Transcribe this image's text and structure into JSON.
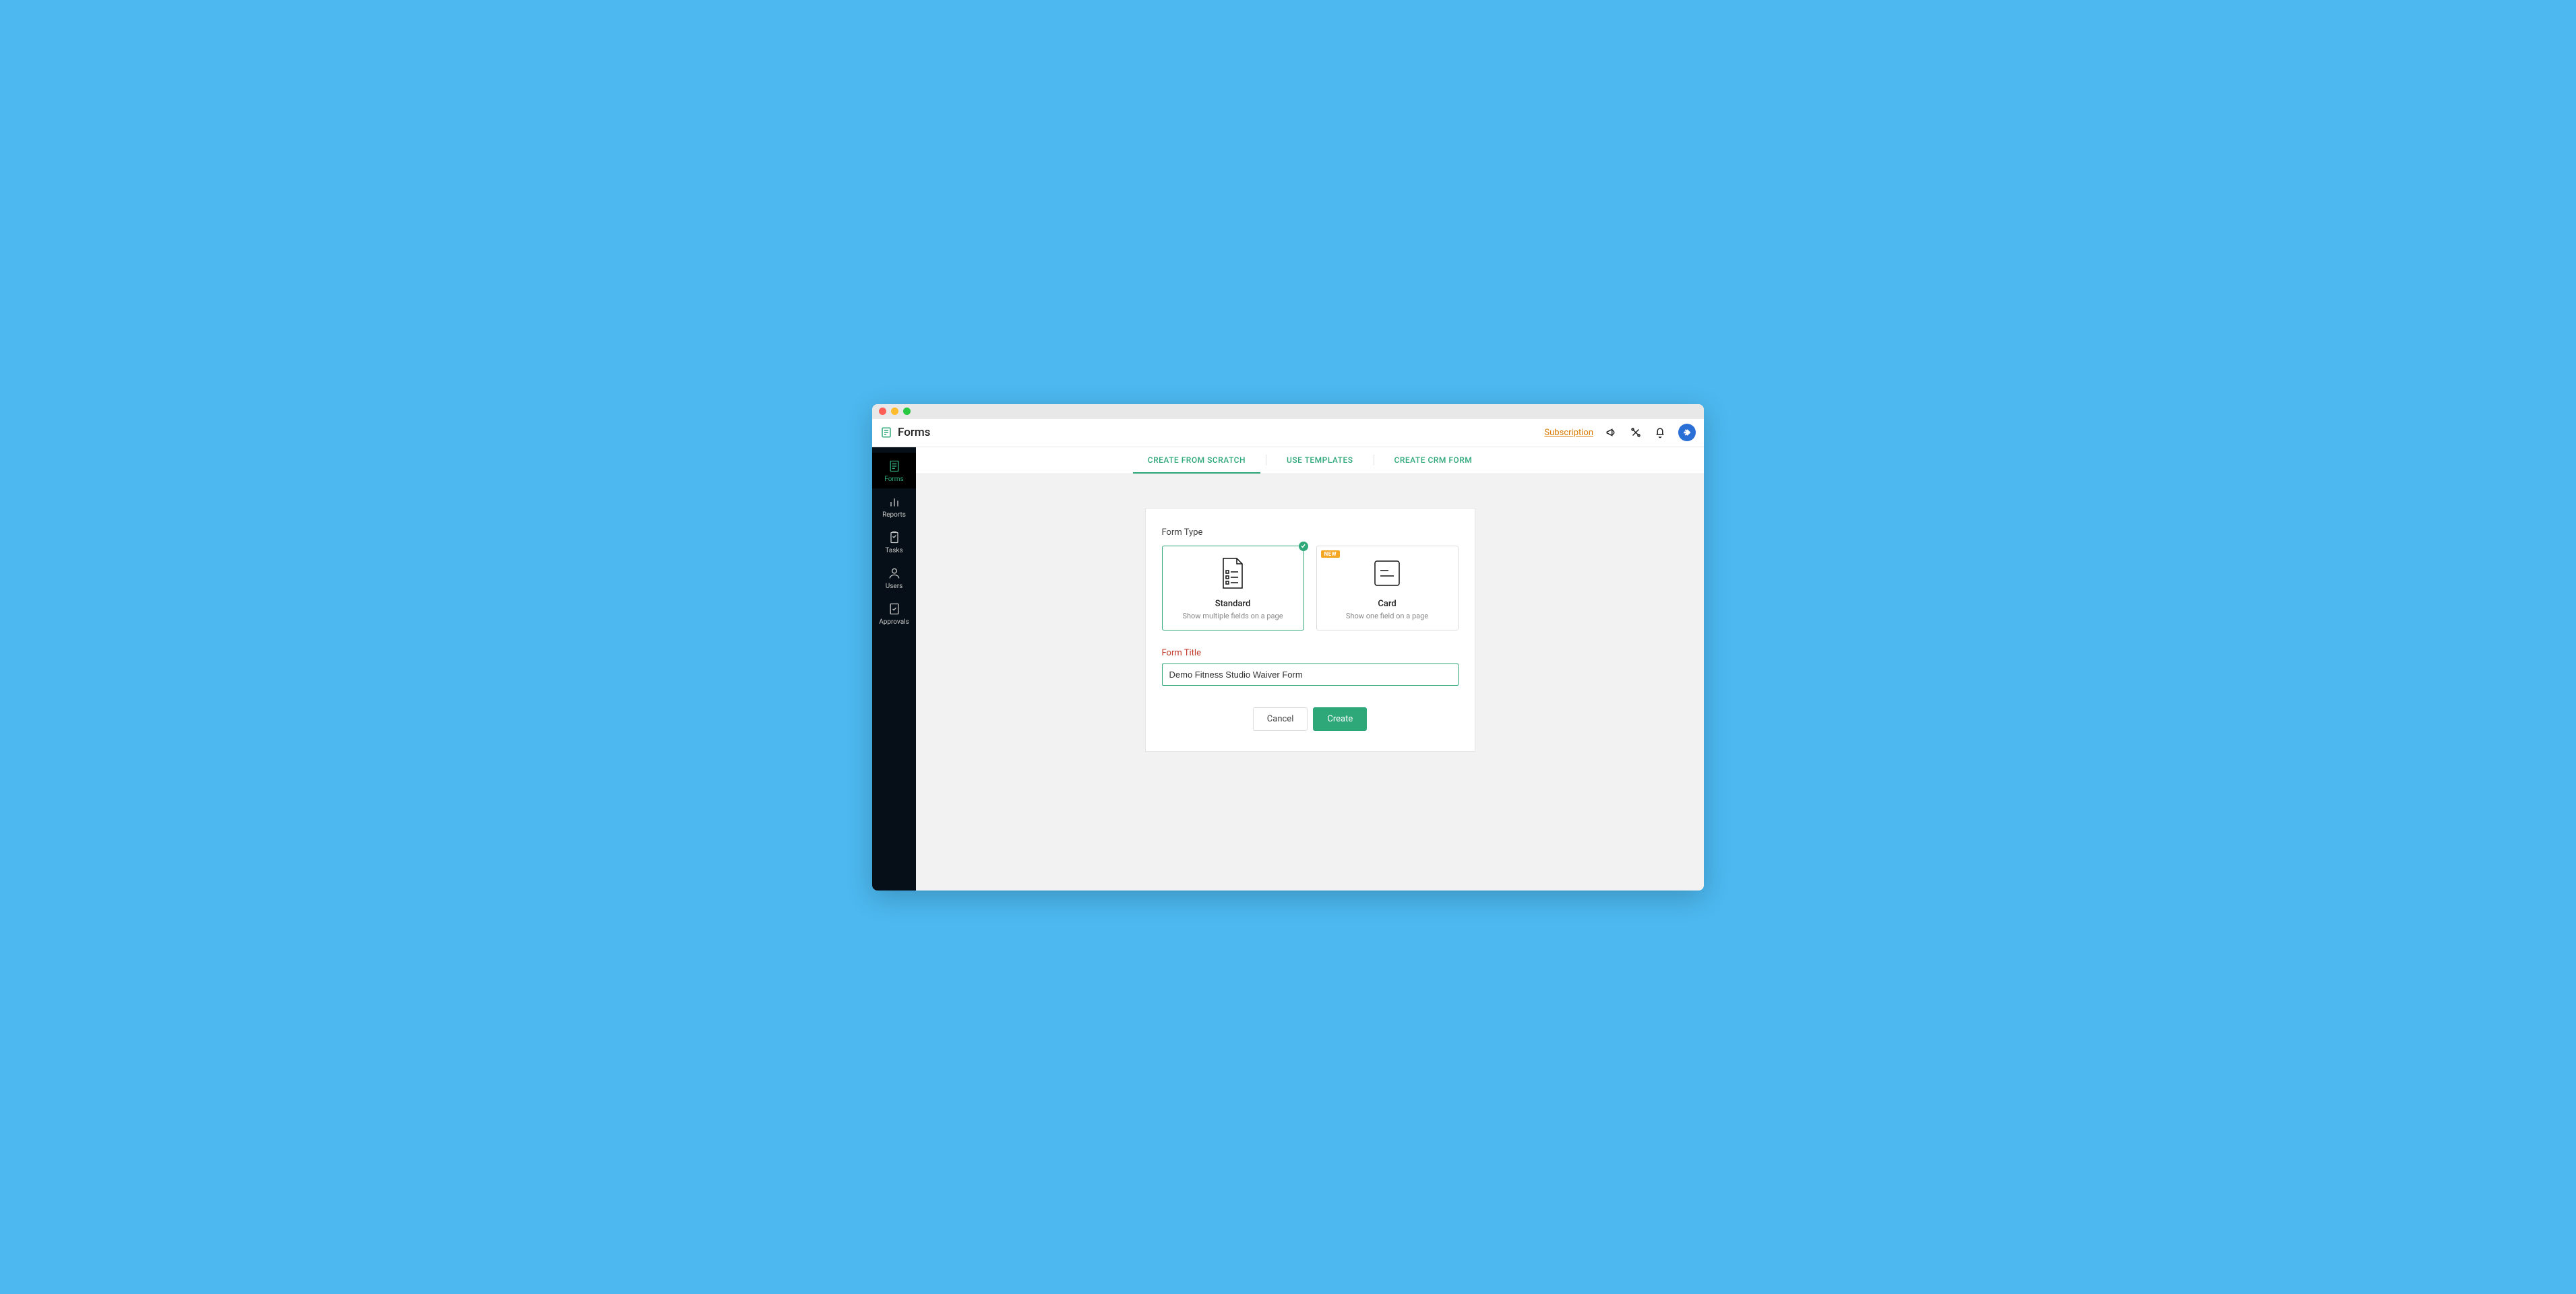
{
  "header": {
    "app_title": "Forms",
    "subscription_label": "Subscription"
  },
  "sidebar": {
    "items": [
      {
        "label": "Forms"
      },
      {
        "label": "Reports"
      },
      {
        "label": "Tasks"
      },
      {
        "label": "Users"
      },
      {
        "label": "Approvals"
      }
    ]
  },
  "tabs": {
    "scratch": "CREATE FROM SCRATCH",
    "templates": "USE TEMPLATES",
    "crm": "CREATE CRM FORM"
  },
  "panel": {
    "form_type_label": "Form Type",
    "standard": {
      "name": "Standard",
      "desc": "Show multiple fields on a page"
    },
    "card": {
      "name": "Card",
      "desc": "Show one field on a page",
      "badge": "NEW"
    },
    "form_title_label": "Form Title",
    "form_title_value": "Demo Fitness Studio Waiver Form",
    "cancel_label": "Cancel",
    "create_label": "Create"
  }
}
